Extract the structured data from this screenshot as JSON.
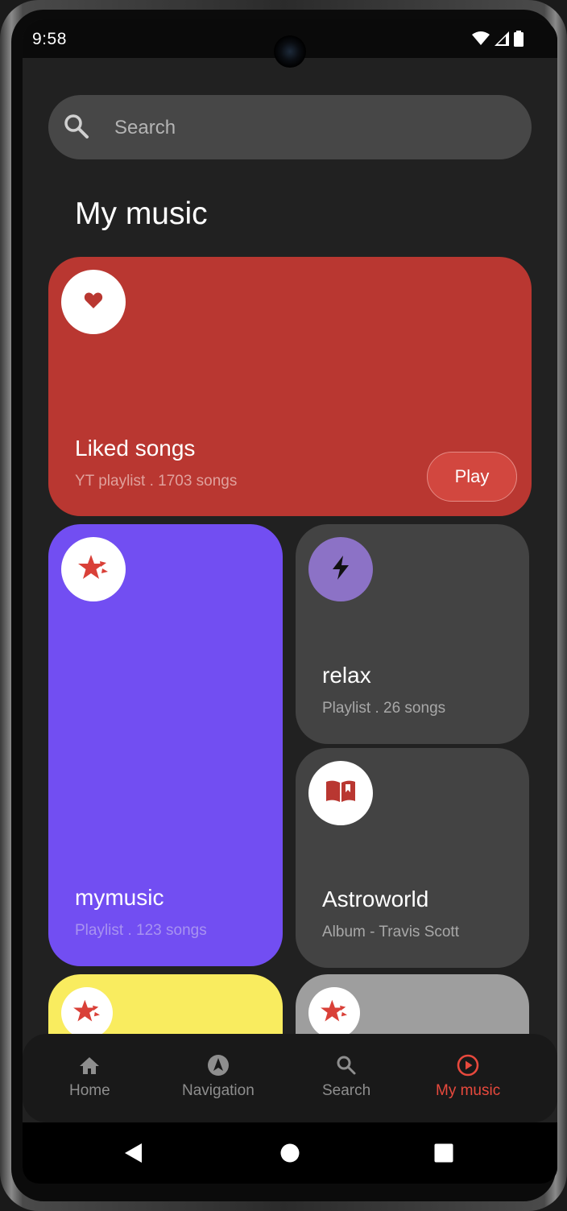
{
  "status_bar": {
    "time": "9:58",
    "wifi_icon": "wifi-icon",
    "signal_icon": "signal-icon",
    "battery_icon": "battery-icon"
  },
  "search": {
    "placeholder": "Search",
    "value": "",
    "icon": "search-icon"
  },
  "page_title": "My music",
  "cards": [
    {
      "id": "liked",
      "title": "Liked songs",
      "subtitle": "YT playlist . 1703 songs",
      "icon": "heart-icon",
      "background": "#b93731",
      "play_label": "Play"
    },
    {
      "id": "mymusic",
      "title": "mymusic",
      "subtitle": "Playlist . 123 songs",
      "icon": "star-icon",
      "background": "#724ef2"
    },
    {
      "id": "relax",
      "title": "relax",
      "subtitle": "Playlist . 26 songs",
      "icon": "bolt-icon",
      "background": "#434343",
      "icon_background": "#8c72c6"
    },
    {
      "id": "astroworld",
      "title": "Astroworld",
      "subtitle": "Album - Travis Scott",
      "icon": "book-icon",
      "background": "#434343"
    },
    {
      "id": "yellow-card",
      "icon": "star-icon",
      "background": "#f9ec5f"
    },
    {
      "id": "grey-card",
      "icon": "star-icon",
      "background": "#9e9e9e"
    }
  ],
  "bottom_nav": {
    "items": [
      {
        "label": "Home",
        "icon": "home-icon",
        "active": false
      },
      {
        "label": "Navigation",
        "icon": "compass-icon",
        "active": false
      },
      {
        "label": "Search",
        "icon": "search-icon",
        "active": false
      },
      {
        "label": "My music",
        "icon": "play-circle-icon",
        "active": true
      }
    ],
    "active_color": "#e8493d"
  },
  "system_nav": {
    "back_icon": "back-triangle-icon",
    "home_icon": "home-circle-icon",
    "recents_icon": "recents-square-icon"
  }
}
